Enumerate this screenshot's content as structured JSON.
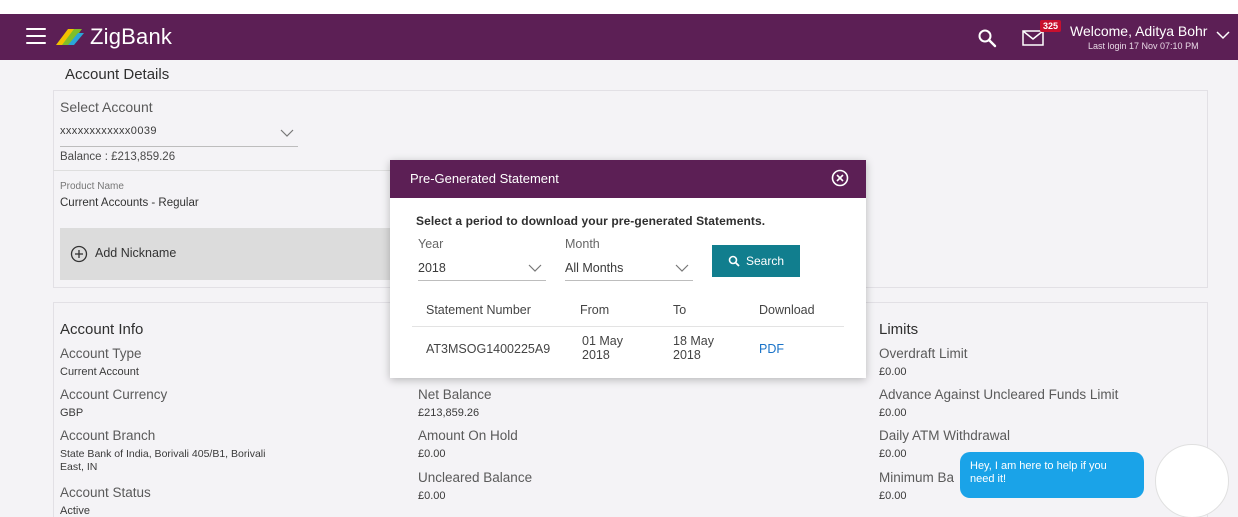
{
  "header": {
    "brand": "ZigBank",
    "mail_badge": "325",
    "welcome": "Welcome, Aditya Bohr",
    "last_login": "Last login 17 Nov 07:10 PM"
  },
  "account_details": {
    "title": "Account Details",
    "select_label": "Select Account",
    "selected_account": "xxxxxxxxxxxx0039",
    "balance": "Balance : £213,859.26",
    "product_label": "Product Name",
    "product_value": "Current Accounts - Regular",
    "add_nickname": "Add Nickname"
  },
  "account_info": {
    "title": "Account Info",
    "type_label": "Account Type",
    "type_value": "Current Account",
    "currency_label": "Account Currency",
    "currency_value": "GBP",
    "branch_label": "Account Branch",
    "branch_value_1": "State Bank of India, Borivali 405/B1, Borivali",
    "branch_value_2": "East, IN",
    "status_label": "Account Status",
    "status_value": "Active"
  },
  "balances": {
    "net_label": "Net Balance",
    "net_value": "£213,859.26",
    "hold_label": "Amount On Hold",
    "hold_value": "£0.00",
    "uncleared_label": "Uncleared Balance",
    "uncleared_value": "£0.00"
  },
  "limits": {
    "title": "Limits",
    "overdraft_label": "Overdraft Limit",
    "overdraft_value": "£0.00",
    "advance_label": "Advance Against Uncleared Funds Limit",
    "advance_value": "£0.00",
    "atm_label": "Daily ATM Withdrawal",
    "atm_value": "£0.00",
    "minimum_label": "Minimum Ba",
    "minimum_value": "£0.00"
  },
  "modal": {
    "title": "Pre-Generated Statement",
    "instruction": "Select a period to download your pre-generated Statements.",
    "year_label": "Year",
    "year_value": "2018",
    "month_label": "Month",
    "month_value": "All Months",
    "search_label": "Search",
    "columns": [
      "Statement Number",
      "From",
      "To",
      "Download"
    ],
    "rows": [
      {
        "statement_number": "AT3MSOG1400225A9",
        "from_1": "01 May",
        "from_2": "2018",
        "to_1": "18 May",
        "to_2": "2018",
        "download": "PDF"
      }
    ]
  },
  "chat": {
    "line_1": "Hey, I am here to help if you",
    "line_2": "need it!"
  },
  "colors": {
    "brand": "#5c1f55",
    "accent": "#117e8e",
    "badge": "#c8102e",
    "chat": "#1aa3e8",
    "link": "#1a73c8"
  }
}
